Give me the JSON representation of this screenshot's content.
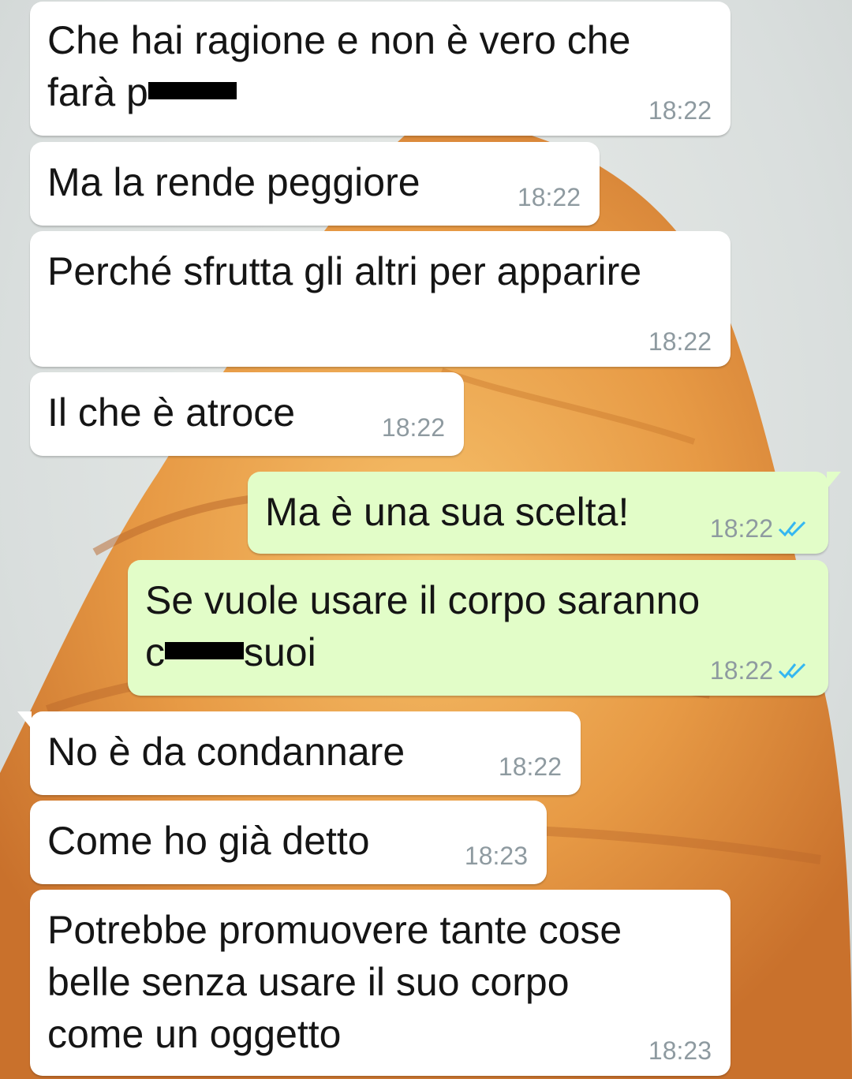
{
  "theme": {
    "incoming_bubble": "#ffffff",
    "outgoing_bubble": "#e2fdc8",
    "read_tick_color": "#34b7f1",
    "wallpaper_description_colors": [
      "#e08a3a",
      "#f2b35c"
    ]
  },
  "messages": [
    {
      "direction": "incoming",
      "text_a": "Che hai ragione e non è vero che\nfarà p",
      "text_b": "",
      "time": "18:22",
      "redacted": true
    },
    {
      "direction": "incoming",
      "text_a": "Ma la rende peggiore",
      "time": "18:22"
    },
    {
      "direction": "incoming",
      "text_a": "Perché sfrutta gli altri per apparire",
      "time": "18:22"
    },
    {
      "direction": "incoming",
      "text_a": "Il che è atroce",
      "time": "18:22"
    },
    {
      "direction": "outgoing",
      "text_a": "Ma è una sua scelta!",
      "time": "18:22",
      "status": "read"
    },
    {
      "direction": "outgoing",
      "text_a": "Se vuole usare il corpo saranno\nc",
      "text_b": "suoi",
      "time": "18:22",
      "status": "read",
      "redacted": true
    },
    {
      "direction": "incoming",
      "text_a": "No è da condannare",
      "time": "18:22"
    },
    {
      "direction": "incoming",
      "text_a": "Come ho già detto",
      "time": "18:23"
    },
    {
      "direction": "incoming",
      "text_a": "Potrebbe promuovere tante cose\nbelle senza usare il suo corpo\ncome un oggetto",
      "time": "18:23"
    }
  ]
}
